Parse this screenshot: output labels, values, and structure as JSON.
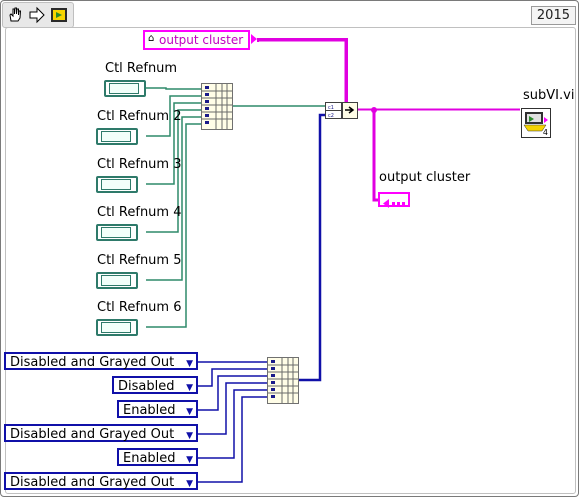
{
  "window": {
    "year": "2015"
  },
  "controls": {
    "refnums": [
      {
        "label": "Ctl Refnum"
      },
      {
        "label": "Ctl Refnum 2"
      },
      {
        "label": "Ctl Refnum 3"
      },
      {
        "label": "Ctl Refnum 4"
      },
      {
        "label": "Ctl Refnum 5"
      },
      {
        "label": "Ctl Refnum 6"
      }
    ],
    "enums": [
      {
        "value": "Disabled and Grayed Out"
      },
      {
        "value": "Disabled"
      },
      {
        "value": "Enabled"
      },
      {
        "value": "Disabled and Grayed Out"
      },
      {
        "value": "Enabled"
      },
      {
        "value": "Disabled and Grayed Out"
      }
    ]
  },
  "local_variable": {
    "label": "output cluster"
  },
  "indicator": {
    "label": "output cluster"
  },
  "subvi": {
    "label": "subVI.vi",
    "terminal_number": "4"
  },
  "colors": {
    "refnum_wire": "#2e8a6a",
    "enum_wire": "#1010a8",
    "cluster_wire": "#e000e0"
  },
  "icons": [
    "operate-hand-icon",
    "run-arrow-icon",
    "highlight-execution-icon"
  ]
}
